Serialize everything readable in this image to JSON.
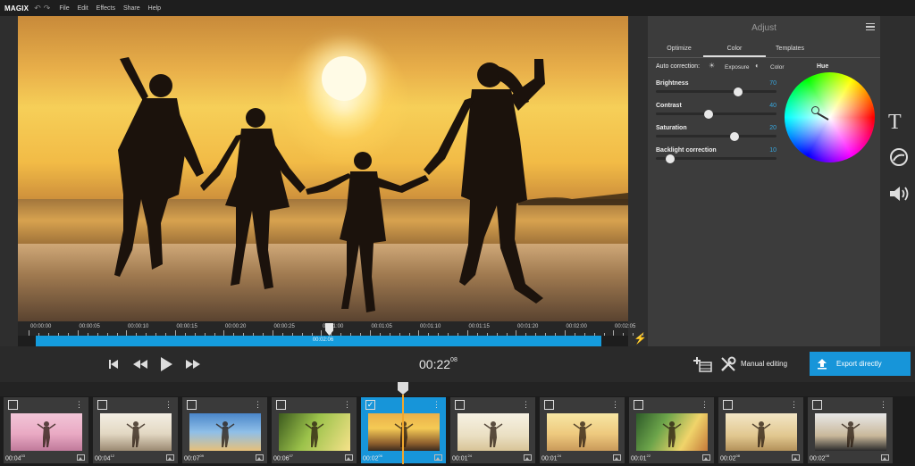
{
  "app": {
    "logo": "MAGIX",
    "menu": [
      "File",
      "Edit",
      "Effects",
      "Share",
      "Help"
    ]
  },
  "scrubber": {
    "ticks": [
      "00:00:00",
      "00:00:05",
      "00:00:10",
      "00:00:15",
      "00:00:20",
      "00:00:25",
      "00:01:00",
      "00:01:05",
      "00:01:10",
      "00:01:15",
      "00:01:20",
      "00:02:00",
      "00:02:05"
    ],
    "current_time": "00:02:06"
  },
  "adjust": {
    "title": "Adjust",
    "tabs": [
      "Optimize",
      "Color",
      "Templates"
    ],
    "active_tab": "Color",
    "auto_correction_label": "Auto correction:",
    "exposure_label": "Exposure",
    "color_label": "Color",
    "hue_label": "Hue",
    "sliders": [
      {
        "label": "Brightness",
        "value": "70",
        "level": 0.68
      },
      {
        "label": "Contrast",
        "value": "40",
        "level": 0.44
      },
      {
        "label": "Saturation",
        "value": "20",
        "level": 0.65
      },
      {
        "label": "Backlight correction",
        "value": "10",
        "level": 0.12
      }
    ]
  },
  "transport": {
    "timecode": "00:22",
    "timecode_frames": "08",
    "manual_editing_label": "Manual editing",
    "export_label": "Export directly"
  },
  "clips": [
    {
      "time": "00:04",
      "frames": "03",
      "checked": false,
      "selected": false,
      "theme": "pink"
    },
    {
      "time": "00:04",
      "frames": "12",
      "checked": false,
      "selected": false,
      "theme": "beige"
    },
    {
      "time": "00:07",
      "frames": "09",
      "checked": false,
      "selected": false,
      "theme": "sky"
    },
    {
      "time": "00:06",
      "frames": "07",
      "checked": false,
      "selected": false,
      "theme": "green"
    },
    {
      "time": "00:02",
      "frames": "06",
      "checked": true,
      "selected": true,
      "theme": "sunset"
    },
    {
      "time": "00:01",
      "frames": "24",
      "checked": false,
      "selected": false,
      "theme": "light"
    },
    {
      "time": "00:01",
      "frames": "24",
      "checked": false,
      "selected": false,
      "theme": "warm"
    },
    {
      "time": "00:01",
      "frames": "22",
      "checked": false,
      "selected": false,
      "theme": "family"
    },
    {
      "time": "00:02",
      "frames": "08",
      "checked": false,
      "selected": false,
      "theme": "desert"
    },
    {
      "time": "00:02",
      "frames": "08",
      "checked": false,
      "selected": false,
      "theme": "dark"
    }
  ],
  "icons": [
    "undo-icon",
    "redo-icon",
    "flash-icon",
    "text-icon",
    "color-wheel-icon",
    "speaker-icon",
    "skip-back-icon",
    "rewind-icon",
    "play-icon",
    "fast-forward-icon",
    "add-media-icon",
    "tools-icon",
    "upload-icon",
    "image-icon"
  ],
  "colors": {
    "accent": "#1795d9",
    "playhead": "#f2a72c",
    "slider_value": "#37a8e0"
  }
}
